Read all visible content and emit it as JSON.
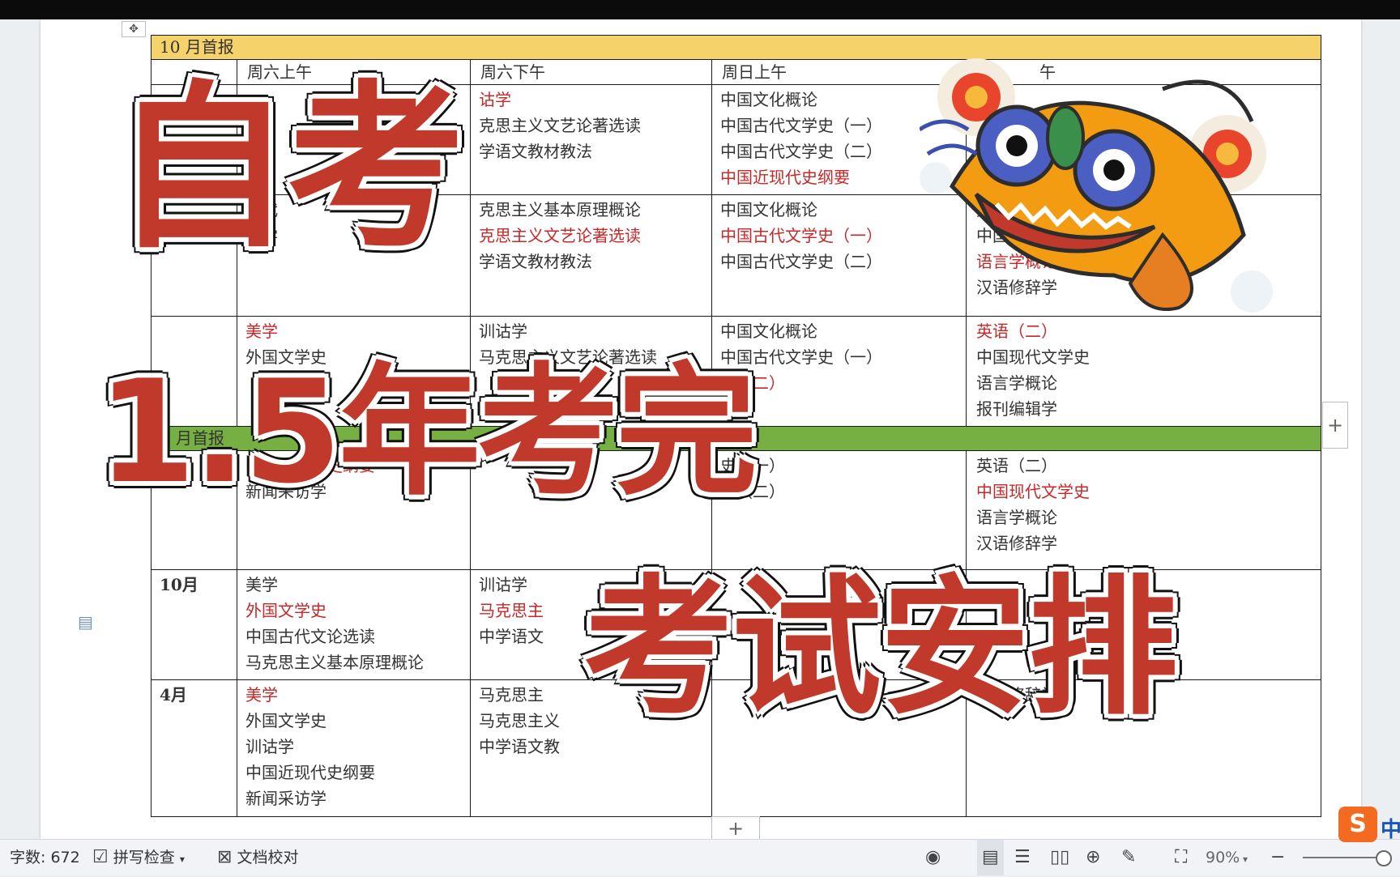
{
  "table": {
    "banner_oct": "10 月首报",
    "col_headers": [
      "周六上午",
      "周六下午",
      "周日上午",
      "午"
    ],
    "rows": [
      {
        "label": "",
        "sat_am": [],
        "sat_pm": [
          {
            "t": "诂学",
            "red": true
          },
          {
            "t": "克思主义文艺论著选读"
          },
          {
            "t": "学语文教材教法"
          }
        ],
        "sun_am": [
          {
            "t": "中国文化概论"
          },
          {
            "t": "中国古代文学史（一）"
          },
          {
            "t": "中国古代文学史（二）"
          },
          {
            "t": "中国近现代史纲要",
            "red": true
          }
        ],
        "sun_pm": []
      },
      {
        "label": "",
        "sat_am": [
          {
            "t": "现代"
          },
          {
            "t": "访学"
          }
        ],
        "sat_pm": [
          {
            "t": "克思主义基本原理概论"
          },
          {
            "t": "克思主义文艺论著选读",
            "red": true
          },
          {
            "t": "学语文教材教法"
          }
        ],
        "sun_am": [
          {
            "t": "中国文化概论"
          },
          {
            "t": "中国古代文学史（一）",
            "red": true
          },
          {
            "t": "中国古代文学史（二）"
          }
        ],
        "sun_pm": [
          {
            "t": "英"
          },
          {
            "t": "中国现"
          },
          {
            "t": "语言学概论",
            "red": true
          },
          {
            "t": "汉语修辞学"
          }
        ]
      },
      {
        "label": "",
        "sat_am": [
          {
            "t": "美学",
            "red": true
          },
          {
            "t": "外国文学史"
          }
        ],
        "sat_pm": [
          {
            "t": "训诂学"
          },
          {
            "t": "马克思主义文艺论著选读"
          }
        ],
        "sun_am": [
          {
            "t": "中国文化概论"
          },
          {
            "t": "中国古代文学史（一）"
          },
          {
            "t": "史（二）",
            "red": true
          },
          {
            "t": "要"
          }
        ],
        "sun_pm": [
          {
            "t": "英语（二）",
            "red": true
          },
          {
            "t": "中国现代文学史"
          },
          {
            "t": "语言学概论"
          },
          {
            "t": "报刊编辑学"
          }
        ]
      }
    ],
    "banner_apr": "月首报",
    "rows2": [
      {
        "label": "",
        "sat_am": [
          {
            "t": "中国近现代史纲要",
            "red": true
          },
          {
            "t": "新闻采访学"
          }
        ],
        "sat_pm": [],
        "sun_am": [
          {
            "t": "史（一）"
          },
          {
            "t": "史（二）"
          }
        ],
        "sun_pm": [
          {
            "t": "英语（二）"
          },
          {
            "t": "中国现代文学史",
            "red": true
          },
          {
            "t": "语言学概论"
          },
          {
            "t": "汉语修辞学"
          }
        ]
      },
      {
        "label": "10月",
        "sat_am": [
          {
            "t": "美学"
          },
          {
            "t": "外国文学史",
            "red": true
          },
          {
            "t": "中国古代文论选读"
          },
          {
            "t": "马克思主义基本原理概论"
          }
        ],
        "sat_pm": [
          {
            "t": "训诂学"
          },
          {
            "t": "马克思主",
            "red": true
          },
          {
            "t": "中学语文"
          }
        ],
        "sun_am": [],
        "sun_pm": []
      },
      {
        "label": "4月",
        "sat_am": [
          {
            "t": "美学",
            "red": true
          },
          {
            "t": "外国文学史"
          },
          {
            "t": "训诂学"
          },
          {
            "t": "中国近现代史纲要"
          },
          {
            "t": "新闻采访学"
          }
        ],
        "sat_pm": [
          {
            "t": "马克思主"
          },
          {
            "t": "马克思主义"
          },
          {
            "t": "中学语文教"
          }
        ],
        "sun_am": [],
        "sun_pm": [
          {
            "t": ""
          },
          {
            "t": ""
          },
          {
            "t": ""
          },
          {
            "t": "汉语修辞学"
          }
        ]
      }
    ]
  },
  "overlay": {
    "title1": "自考",
    "title2": "1.5年考完",
    "title3": "考试安排"
  },
  "statusbar": {
    "word_count": "字数: 672",
    "spell_check": "拼写检查",
    "doc_proof": "文档校对",
    "zoom": "90%"
  },
  "ime": {
    "badge": "S",
    "mode": "中"
  },
  "buttons": {
    "plus": "+"
  },
  "colors": {
    "accent_red": "#c0392b",
    "banner_yellow": "#f5d36a",
    "banner_green": "#76b043"
  },
  "icons": {
    "doc": "document-icon",
    "lion": "lion-dance-sticker"
  }
}
